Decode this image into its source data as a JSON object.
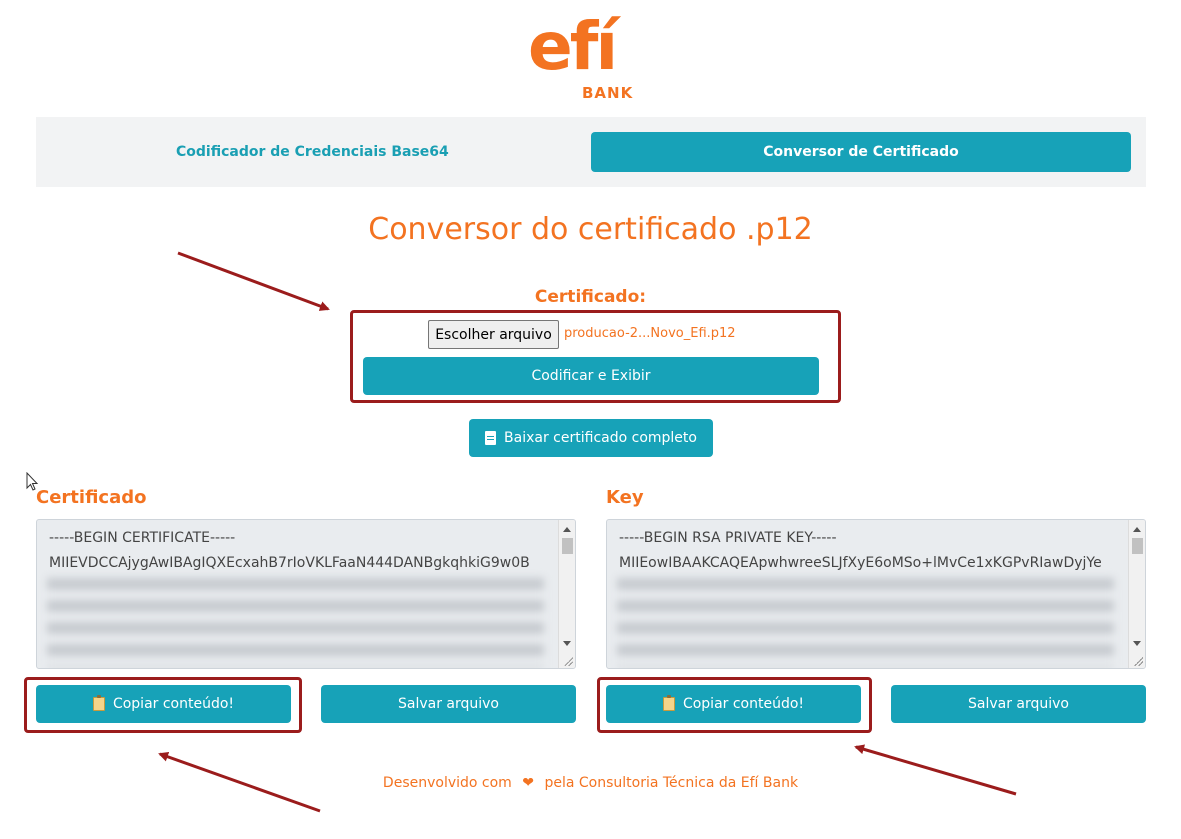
{
  "brand": {
    "logo_word": "efí",
    "logo_sub": "BANK",
    "color": "#f37321",
    "accent": "#17a2b8"
  },
  "tabs": [
    {
      "label": "Codificador de Credenciais Base64",
      "active": false
    },
    {
      "label": "Conversor de Certificado",
      "active": true
    }
  ],
  "page_title": "Conversor do certificado .p12",
  "upload": {
    "label": "Certificado:",
    "file_button": "Escolher arquivo",
    "file_name": "producao-2...Novo_Efi.p12",
    "encode_button": "Codificar e Exibir"
  },
  "download_button": {
    "label": "Baixar certificado completo",
    "icon": "document-icon"
  },
  "panels": {
    "certificate": {
      "title": "Certificado",
      "line1": "-----BEGIN CERTIFICATE-----",
      "line2": "MIIEVDCCAjygAwIBAgIQXEcxahB7rIoVKLFaaN444DANBgkqhkiG9w0B",
      "copy_button": "Copiar conteúdo!",
      "save_button": "Salvar arquivo"
    },
    "key": {
      "title": "Key",
      "line1": "-----BEGIN RSA PRIVATE KEY-----",
      "line2": "MIIEowIBAAKCAQEApwhwreeSLJfXyE6oMSo+lMvCe1xKGPvRIawDyjYe",
      "copy_button": "Copiar conteúdo!",
      "save_button": "Salvar arquivo"
    }
  },
  "footer": {
    "prefix": "Desenvolvido com",
    "suffix": "pela Consultoria Técnica da Efí Bank",
    "heart": "heart-icon"
  },
  "annotation_color": "#9b1c1c"
}
